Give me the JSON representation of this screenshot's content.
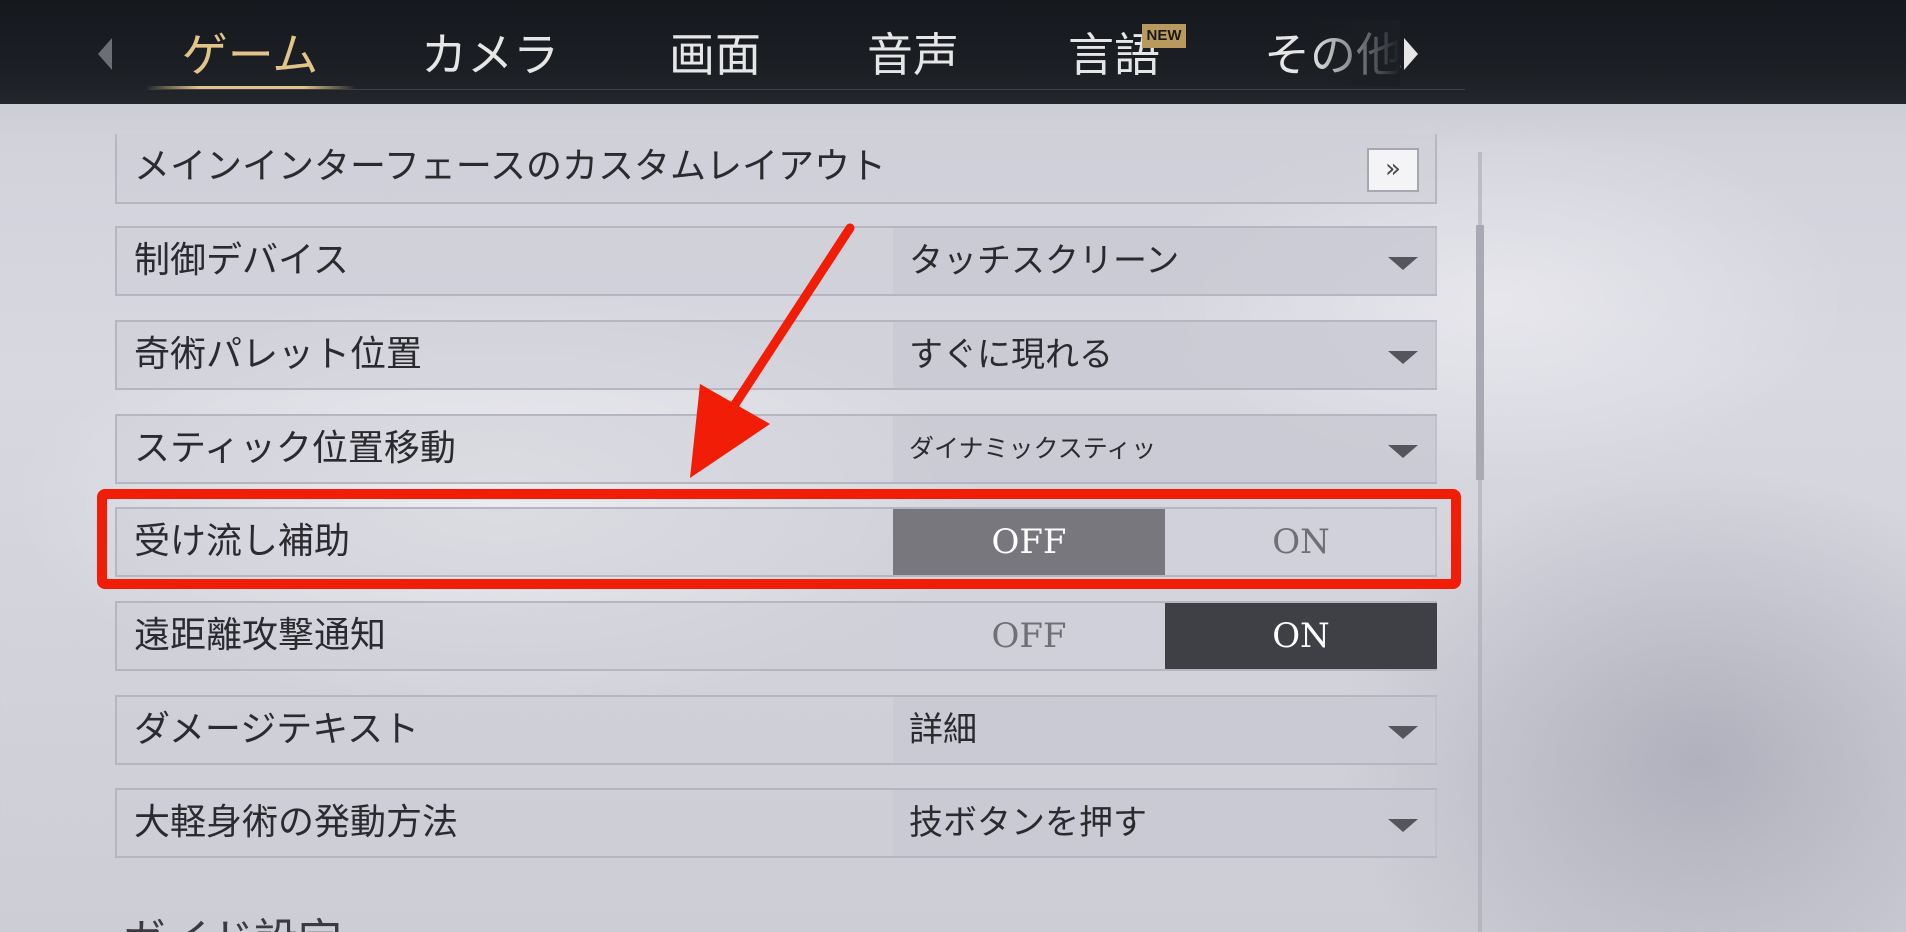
{
  "tabs": [
    {
      "label": "ゲーム",
      "active": true
    },
    {
      "label": "カメラ",
      "active": false
    },
    {
      "label": "画面",
      "active": false
    },
    {
      "label": "音声",
      "active": false
    },
    {
      "label": "言語",
      "active": false,
      "badge": "NEW"
    },
    {
      "label": "その他",
      "active": false
    }
  ],
  "settings": {
    "custom_layout": {
      "label": "メインインターフェースのカスタムレイアウト",
      "button_icon": "double-chevron-right-icon",
      "button_text": "»"
    },
    "control_device": {
      "label": "制御デバイス",
      "value": "タッチスクリーン"
    },
    "palette_position": {
      "label": "奇術パレット位置",
      "value": "すぐに現れる"
    },
    "stick_move": {
      "label": "スティック位置移動",
      "value": "ダイナミックスティッ"
    },
    "parry_assist": {
      "label": "受け流し補助",
      "off": "OFF",
      "on": "ON",
      "selected": "OFF"
    },
    "ranged_notice": {
      "label": "遠距離攻撃通知",
      "off": "OFF",
      "on": "ON",
      "selected": "ON"
    },
    "damage_text": {
      "label": "ダメージテキスト",
      "value": "詳細"
    },
    "lightness_skill": {
      "label": "大軽身術の発動方法",
      "value": "技ボタンを押す"
    }
  },
  "section_header": "ガイド設定",
  "annotation": {
    "color": "#f21d07",
    "target": "parry_assist"
  },
  "colors": {
    "accent": "#e2c38a",
    "bar": "#1b1f24"
  }
}
